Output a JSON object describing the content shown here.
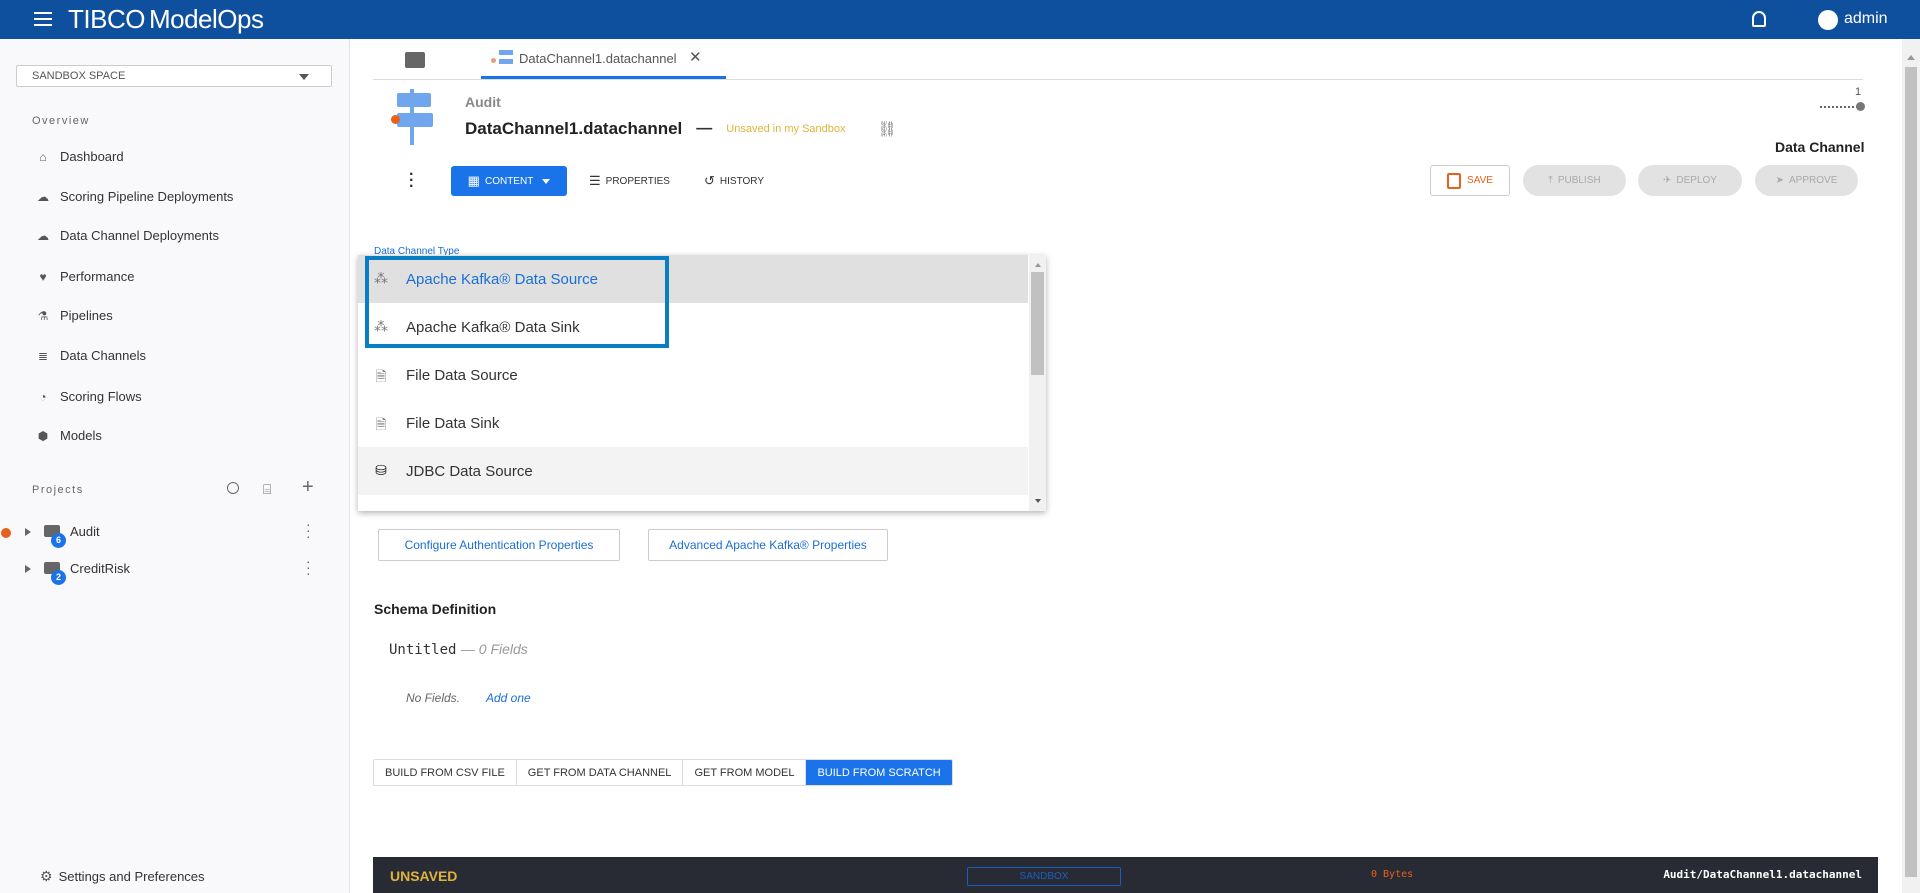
{
  "header": {
    "brand": "TIBCO",
    "product": "ModelOps",
    "user": "admin"
  },
  "sidebar": {
    "space_select": "SANDBOX SPACE",
    "overview_heading": "Overview",
    "items": [
      {
        "label": "Dashboard",
        "icon": "home-icon"
      },
      {
        "label": "Scoring Pipeline Deployments",
        "icon": "cloud-upload-icon"
      },
      {
        "label": "Data Channel Deployments",
        "icon": "cloud-upload-icon"
      },
      {
        "label": "Performance",
        "icon": "heart-pulse-icon"
      },
      {
        "label": "Pipelines",
        "icon": "pipeline-icon"
      },
      {
        "label": "Data Channels",
        "icon": "database-icon"
      },
      {
        "label": "Scoring Flows",
        "icon": "gauge-icon"
      },
      {
        "label": "Models",
        "icon": "cube-icon"
      }
    ],
    "projects_heading": "Projects",
    "projects": [
      {
        "name": "Audit",
        "count": "6",
        "unsaved": true
      },
      {
        "name": "CreditRisk",
        "count": "2",
        "unsaved": false
      }
    ],
    "settings": "Settings and Preferences"
  },
  "tabs": [
    {
      "label": "DataChannel1.datachannel"
    }
  ],
  "artifact": {
    "project": "Audit",
    "name": "DataChannel1.datachannel",
    "dash": "—",
    "status": "Unsaved in my Sandbox",
    "type": "Data Channel",
    "version": "1"
  },
  "toolbar": {
    "content": "CONTENT",
    "properties": "PROPERTIES",
    "history": "HISTORY",
    "save": "SAVE",
    "publish": "PUBLISH",
    "deploy": "DEPLOY",
    "approve": "APPROVE"
  },
  "form": {
    "type_label": "Data Channel Type",
    "options": [
      {
        "label": "Apache Kafka® Data Source",
        "icon": "kafka-icon"
      },
      {
        "label": "Apache Kafka® Data Sink",
        "icon": "kafka-icon"
      },
      {
        "label": "File Data Source",
        "icon": "csv-file-icon"
      },
      {
        "label": "File Data Sink",
        "icon": "csv-file-icon"
      },
      {
        "label": "JDBC Data Source",
        "icon": "jdbc-database-icon"
      }
    ],
    "auth_button": "Configure Authentication Properties",
    "advanced_button": "Advanced Apache Kafka® Properties"
  },
  "schema": {
    "heading": "Schema Definition",
    "name": "Untitled",
    "fields_count": "— 0 Fields",
    "no_fields": "No Fields.",
    "add_one": "Add one",
    "build_options": [
      "BUILD FROM CSV FILE",
      "GET FROM DATA CHANNEL",
      "GET FROM MODEL",
      "BUILD FROM SCRATCH"
    ]
  },
  "footer": {
    "status": "UNSAVED",
    "space": "SANDBOX",
    "size": "0 Bytes",
    "path": "Audit/DataChannel1.datachannel"
  },
  "colors": {
    "header": "#0f509e",
    "accent": "#1a73e8",
    "unsaved": "#e8601c",
    "status_yellow": "#e0b43c"
  }
}
